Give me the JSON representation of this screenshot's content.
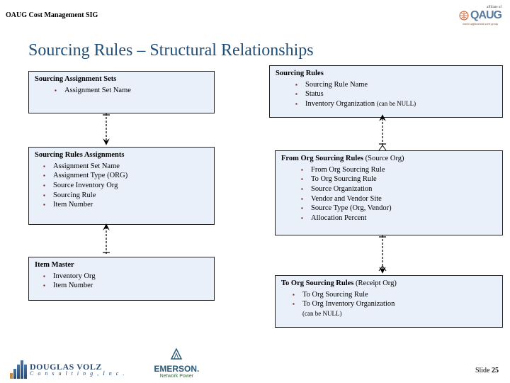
{
  "header": {
    "sig": "OAUG Cost Management SIG",
    "affiliate": "affiliate of",
    "logo_text": "QAUG",
    "logo_sub": "oracle applications users group"
  },
  "title": "Sourcing Rules – Structural Relationships",
  "boxes": {
    "sas": {
      "title": "Sourcing Assignment Sets",
      "items": [
        "Assignment Set Name"
      ]
    },
    "sra": {
      "title": "Sourcing Rules Assignments",
      "items": [
        "Assignment Set Name",
        "Assignment Type (ORG)",
        "Source Inventory Org",
        "Sourcing Rule",
        "Item Number"
      ]
    },
    "im": {
      "title": "Item Master",
      "items": [
        "Inventory Org",
        "Item Number"
      ]
    },
    "sr": {
      "title": "Sourcing Rules",
      "items": [
        "Sourcing Rule Name",
        "Status",
        "Inventory Organization"
      ],
      "note3": "(can be NULL)"
    },
    "from": {
      "title_a": "From Org Sourcing Rules",
      "title_b": "(Source Org)",
      "items": [
        "From Org Sourcing Rule",
        "To Org Sourcing Rule",
        "Source Organization",
        "Vendor and Vendor Site",
        "Source Type (Org, Vendor)",
        "Allocation Percent"
      ]
    },
    "to": {
      "title_a": "To Org Sourcing Rules",
      "title_b": "(Receipt Org)",
      "items": [
        "To Org Sourcing Rule",
        "To Org Inventory Organization"
      ],
      "note2": "(can be NULL)"
    }
  },
  "footer": {
    "dv1": "DOUGLAS VOLZ",
    "dv2": "C o n s u l t i n g , I n c .",
    "em1": "EMERSON.",
    "em2": "Network Power",
    "slide_label": "Slide ",
    "slide_num": "25"
  }
}
